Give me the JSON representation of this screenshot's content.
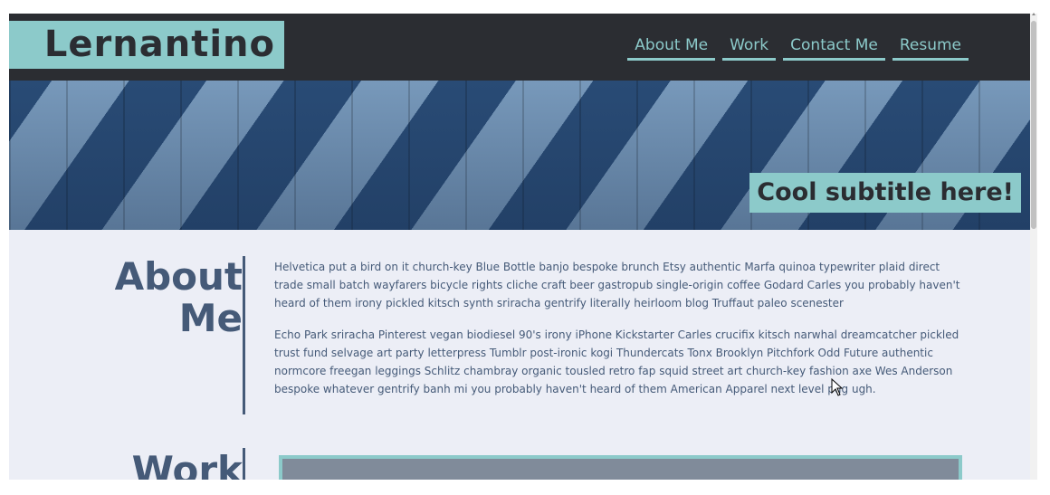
{
  "header": {
    "logo": "Lernantino",
    "nav": [
      {
        "label": "About Me"
      },
      {
        "label": "Work"
      },
      {
        "label": "Contact Me"
      },
      {
        "label": "Resume"
      }
    ]
  },
  "hero": {
    "subtitle": "Cool subtitle here!"
  },
  "about": {
    "title_line1": "About",
    "title_line2": "Me",
    "paragraphs": [
      "Helvetica put a bird on it church-key Blue Bottle banjo bespoke brunch Etsy authentic Marfa quinoa typewriter plaid direct trade small batch wayfarers bicycle rights cliche craft beer gastropub single-origin coffee Godard Carles you probably haven't heard of them irony pickled kitsch synth sriracha gentrify literally heirloom blog Truffaut paleo scenester",
      "Echo Park sriracha Pinterest vegan biodiesel 90's irony iPhone Kickstarter Carles crucifix kitsch narwhal dreamcatcher pickled trust fund selvage art party letterpress Tumblr post-ironic kogi Thundercats Tonx Brooklyn Pitchfork Odd Future authentic normcore freegan leggings Schlitz chambray organic tousled retro fap squid street art church-key fashion axe Wes Anderson bespoke whatever gentrify banh mi you probably haven't heard of them American Apparel next level pug ugh."
    ]
  },
  "work": {
    "title": "Work"
  },
  "colors": {
    "accent": "#8ccaca",
    "header_bg": "#2b2d32",
    "page_bg": "#eceef6",
    "heading": "#455a78"
  }
}
